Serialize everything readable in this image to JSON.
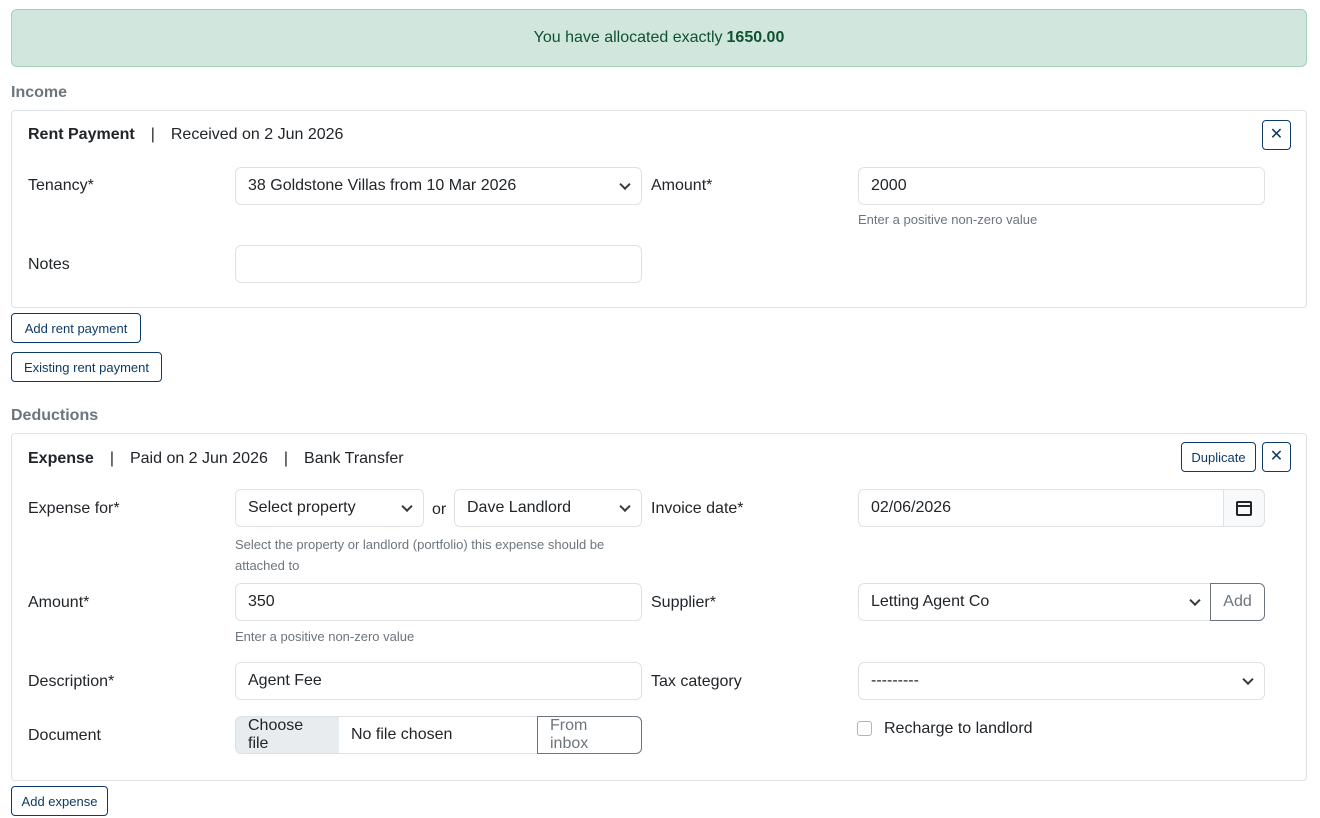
{
  "alert": {
    "text": "You have allocated exactly",
    "amount": "1650.00"
  },
  "income": {
    "section_label": "Income",
    "card": {
      "title": "Rent Payment",
      "separator": "|",
      "received": "Received on 2 Jun 2026",
      "close_label": "✕",
      "tenancy_label": "Tenancy*",
      "tenancy_value": "38 Goldstone Villas from 10 Mar 2026",
      "amount_label": "Amount*",
      "amount_value": "2000",
      "amount_help": "Enter a positive non-zero value",
      "notes_label": "Notes",
      "notes_value": ""
    },
    "add_button": "Add rent payment",
    "existing_button": "Existing rent payment"
  },
  "deductions": {
    "section_label": "Deductions",
    "card": {
      "title": "Expense",
      "separator": "|",
      "paid": "Paid on 2 Jun 2026",
      "method": "Bank Transfer",
      "duplicate_label": "Duplicate",
      "close_label": "✕",
      "expense_for_label": "Expense for*",
      "property_select": "Select property",
      "or_text": "or",
      "landlord_select": "Dave Landlord",
      "expense_for_help": "Select the property or landlord (portfolio) this expense should be attached to",
      "invoice_date_label": "Invoice date*",
      "invoice_date_value": "02/06/2026",
      "amount_label": "Amount*",
      "amount_value": "350",
      "amount_help": "Enter a positive non-zero value",
      "supplier_label": "Supplier*",
      "supplier_value": "Letting Agent Co",
      "supplier_add": "Add",
      "description_label": "Description*",
      "description_value": "Agent Fee",
      "tax_category_label": "Tax category",
      "tax_category_value": "---------",
      "document_label": "Document",
      "choose_file": "Choose file",
      "no_file": "No file chosen",
      "from_inbox": "From inbox",
      "recharge_label": "Recharge to landlord"
    },
    "add_button": "Add expense"
  },
  "colors": {
    "alert_bg": "#d1e7dd",
    "alert_text": "#0f5132",
    "button_outline": "#0d3b66"
  }
}
